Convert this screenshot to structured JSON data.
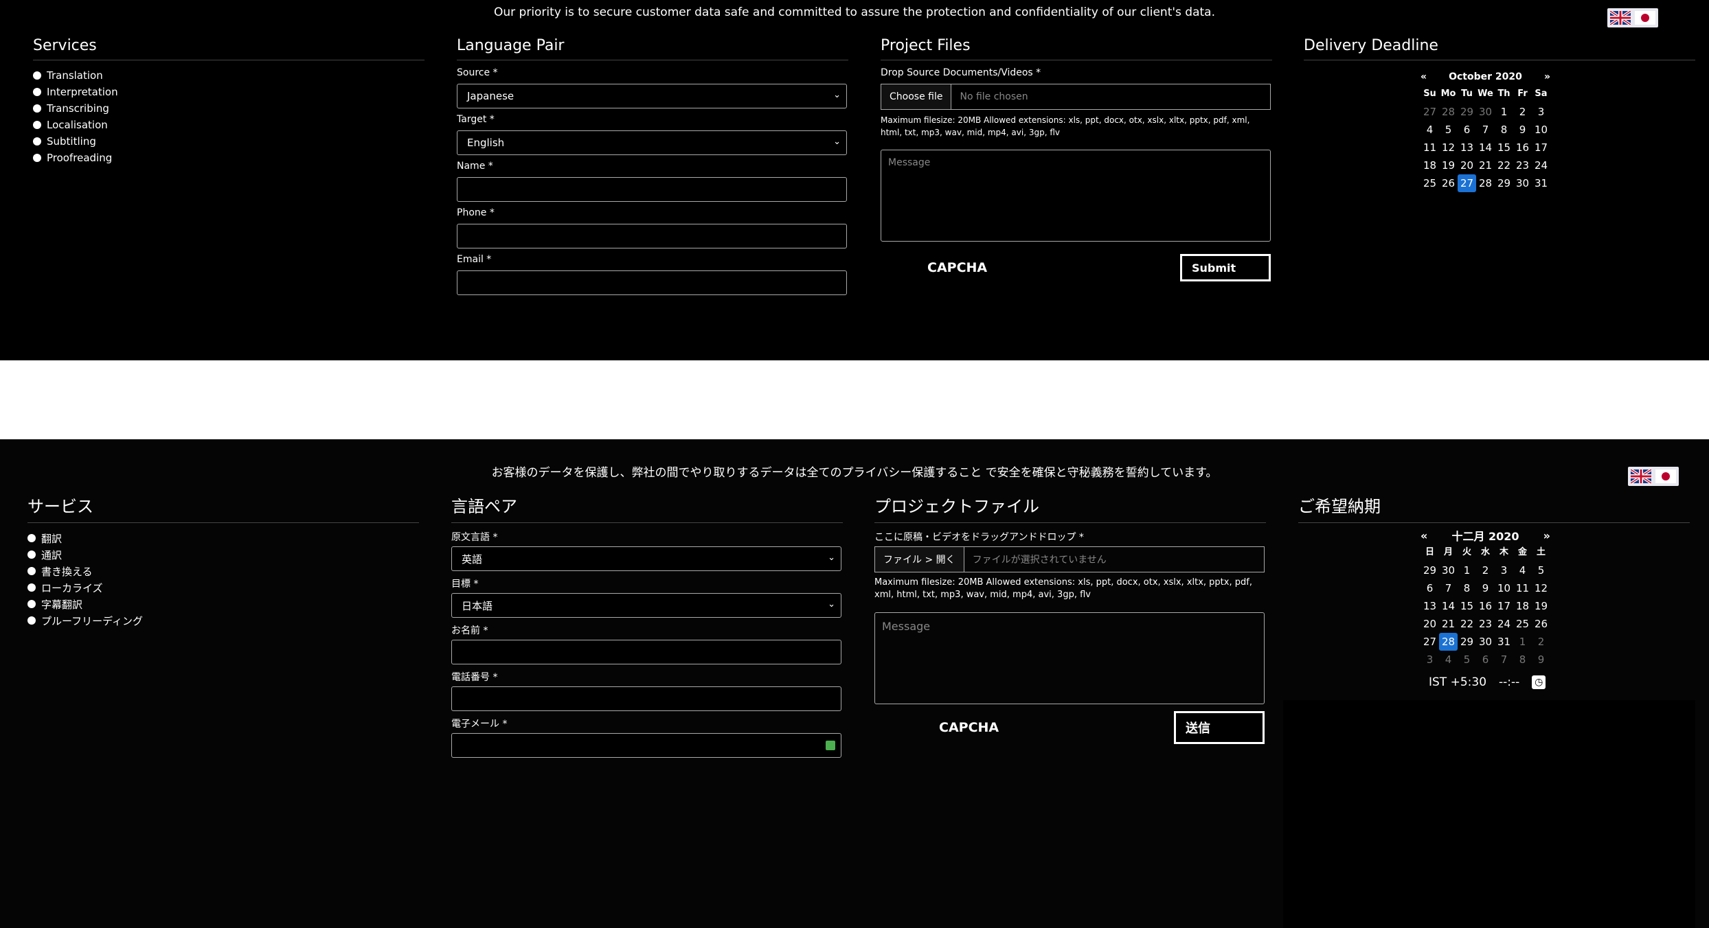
{
  "english": {
    "notice": "Our priority is to secure customer data safe and committed to assure the protection and confidentiality of our client's data.",
    "services": {
      "title": "Services",
      "items": [
        "Translation",
        "Interpretation",
        "Transcribing",
        "Localisation",
        "Subtitling",
        "Proofreading"
      ]
    },
    "language_pair": {
      "title": "Language Pair",
      "source_label": "Source *",
      "source_value": "Japanese",
      "target_label": "Target *",
      "target_value": "English",
      "name_label": "Name *",
      "phone_label": "Phone *",
      "email_label": "Email *"
    },
    "project_files": {
      "title": "Project Files",
      "drop_label": "Drop Source Documents/Videos *",
      "choose_file": "Choose file",
      "no_file": "No file chosen",
      "note": "Maximum filesize: 20MB Allowed extensions: xls, ppt, docx, otx, xslx, xltx, pptx, pdf, xml, html, txt, mp3, wav, mid, mp4, avi, 3gp, flv",
      "message_placeholder": "Message",
      "capcha": "CAPCHA",
      "submit": "Submit"
    },
    "deadline": {
      "title": "Delivery Deadline",
      "prev": "«",
      "next": "»",
      "month": "October 2020",
      "weekdays": [
        "Su",
        "Mo",
        "Tu",
        "We",
        "Th",
        "Fr",
        "Sa"
      ],
      "days": [
        "27",
        "28",
        "29",
        "30",
        "1",
        "2",
        "3",
        "4",
        "5",
        "6",
        "7",
        "8",
        "9",
        "10",
        "11",
        "12",
        "13",
        "14",
        "15",
        "16",
        "17",
        "18",
        "19",
        "20",
        "21",
        "22",
        "23",
        "24",
        "25",
        "26",
        "27",
        "28",
        "29",
        "30",
        "31"
      ],
      "selected_index": 30,
      "dim_indices": [
        0,
        1,
        2,
        3
      ]
    }
  },
  "japanese": {
    "notice": "お客様のデータを保護し、弊社の間でやり取りするデータは全てのプライバシー保護すること で安全を確保と守秘義務を誓約しています。",
    "services": {
      "title": "サービス",
      "items": [
        "翻訳",
        "通訳",
        "書き換える",
        "ローカライズ",
        "字幕翻訳",
        "プルーフリーディング"
      ]
    },
    "language_pair": {
      "title": "言語ペア",
      "source_label": "原文言語 *",
      "source_value": "英語",
      "target_label": "目標 *",
      "target_value": "日本語",
      "name_label": "お名前 *",
      "phone_label": "電話番号 *",
      "email_label": "電子メール *"
    },
    "project_files": {
      "title": "プロジェクトファイル",
      "drop_label": "ここに原稿・ビデオをドラッグアンドドロップ *",
      "choose_file": "ファイル > 開く",
      "no_file": "ファイルが選択されていません",
      "note": "Maximum filesize: 20MB Allowed extensions: xls, ppt, docx, otx, xslx, xltx, pptx, pdf, xml, html, txt, mp3, wav, mid, mp4, avi, 3gp, flv",
      "message_placeholder": "Message",
      "capcha": "CAPCHA",
      "submit": "送信"
    },
    "deadline": {
      "title": "ご希望納期",
      "prev": "«",
      "next": "»",
      "month": "十二月 2020",
      "weekdays": [
        "日",
        "月",
        "火",
        "水",
        "木",
        "金",
        "土"
      ],
      "days": [
        "29",
        "30",
        "1",
        "2",
        "3",
        "4",
        "5",
        "6",
        "7",
        "8",
        "9",
        "10",
        "11",
        "12",
        "13",
        "14",
        "15",
        "16",
        "17",
        "18",
        "19",
        "20",
        "21",
        "22",
        "23",
        "24",
        "25",
        "26",
        "27",
        "28",
        "29",
        "30",
        "31",
        "1",
        "2",
        "3",
        "4",
        "5",
        "6",
        "7",
        "8",
        "9"
      ],
      "selected_index": 29,
      "dim_indices": [
        33,
        34,
        35,
        36,
        37,
        38,
        39,
        40,
        41
      ],
      "timezone": "IST +5:30",
      "time_value": "--:--"
    }
  },
  "colors": {
    "selected_day": "#1b72d4",
    "background": "#000000",
    "band": "#ffffff"
  }
}
